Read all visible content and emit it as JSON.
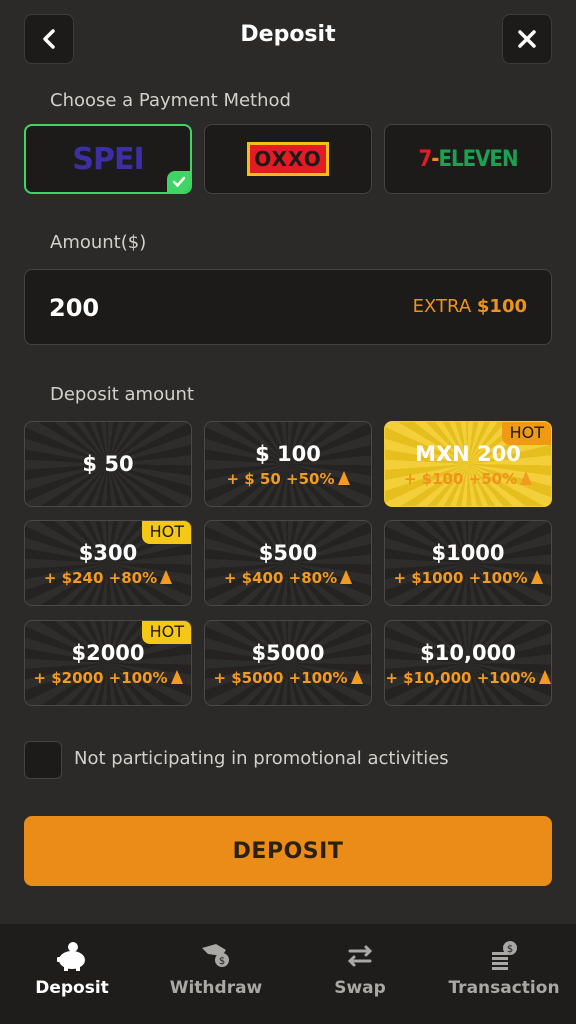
{
  "header": {
    "title": "Deposit",
    "back_icon": "chevron-left-icon",
    "close_icon": "close-icon"
  },
  "payment": {
    "label": "Choose a Payment Method",
    "methods": [
      {
        "name": "SPEI",
        "logo_text": "SPEI",
        "selected": true
      },
      {
        "name": "OXXO",
        "logo_text": "OXXO",
        "selected": false
      },
      {
        "name": "7-ELEVEN",
        "logo_num": "7",
        "logo_word": "ELEVEN",
        "selected": false
      }
    ]
  },
  "amount": {
    "label": "Amount($)",
    "value": "200",
    "extra_prefix": "EXTRA",
    "extra_value": "$100"
  },
  "deposit_amount": {
    "label": "Deposit amount",
    "tiles": [
      {
        "main": "$ 50",
        "bonus": "",
        "hot": ""
      },
      {
        "main": "$ 100",
        "bonus": "+ $ 50 +50%",
        "hot": ""
      },
      {
        "main": "MXN 200",
        "bonus": "+ $100 +50%",
        "hot": "HOT",
        "highlight": true
      },
      {
        "main": "$300",
        "bonus": "+ $240 +80%",
        "hot": "HOT"
      },
      {
        "main": "$500",
        "bonus": "+ $400 +80%",
        "hot": ""
      },
      {
        "main": "$1000",
        "bonus": "+ $1000 +100%",
        "hot": ""
      },
      {
        "main": "$2000",
        "bonus": "+ $2000 +100%",
        "hot": "HOT"
      },
      {
        "main": "$5000",
        "bonus": "+ $5000 +100%",
        "hot": ""
      },
      {
        "main": "$10,000",
        "bonus": "+ $10,000 +100%",
        "hot": ""
      }
    ]
  },
  "promo": {
    "label": "Not participating in promotional activities",
    "checked": false
  },
  "deposit_button": {
    "label": "DEPOSIT"
  },
  "nav": [
    {
      "label": "Deposit",
      "icon": "piggy-bank-icon",
      "active": true
    },
    {
      "label": "Withdraw",
      "icon": "withdraw-hand-icon",
      "active": false
    },
    {
      "label": "Swap",
      "icon": "swap-arrows-icon",
      "active": false
    },
    {
      "label": "Transaction",
      "icon": "coins-stack-icon",
      "active": false
    }
  ],
  "colors": {
    "accent": "#ec8c18",
    "selected": "#3ed564",
    "hot": "#f5c816",
    "background": "#2b2a28"
  }
}
